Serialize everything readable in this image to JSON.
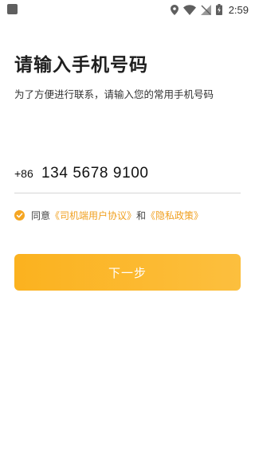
{
  "status_bar": {
    "time": "2:59",
    "icons": [
      "notification-icon",
      "location-icon",
      "wifi-icon",
      "no-signal-icon",
      "battery-charging-icon"
    ]
  },
  "login": {
    "title": "请输入手机号码",
    "subtitle": "为了方便进行联系，请输入您的常用手机号码",
    "country_code": "+86",
    "phone_value": "134 5678 9100"
  },
  "agreement": {
    "checked": true,
    "prefix": "同意",
    "driver_agreement": "《司机端用户协议》",
    "and": "和",
    "privacy_policy": "《隐私政策》"
  },
  "actions": {
    "next_label": "下一步"
  },
  "colors": {
    "accent": "#f5a623",
    "button_start": "#fbb21f",
    "button_end": "#fcbf3e",
    "link": "#f0a020",
    "divider": "#d6d6d6"
  }
}
